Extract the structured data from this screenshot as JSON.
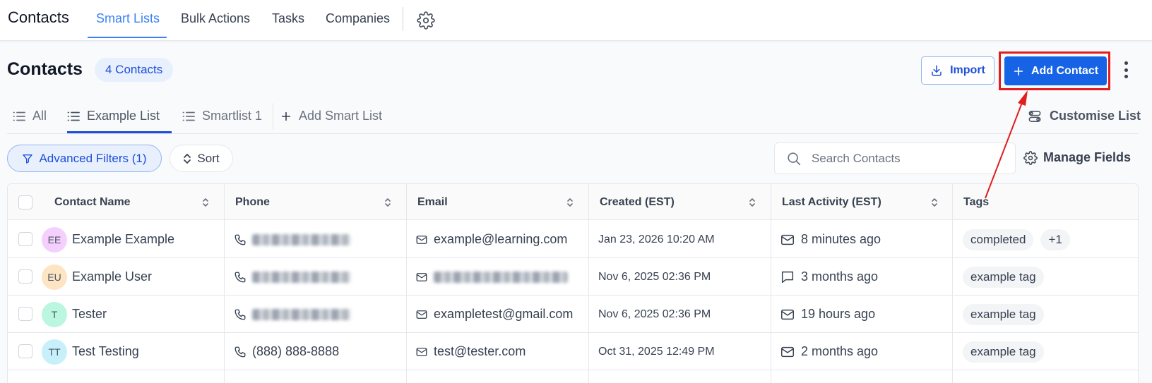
{
  "topnav": {
    "title": "Contacts",
    "tabs": [
      "Smart Lists",
      "Bulk Actions",
      "Tasks",
      "Companies"
    ],
    "active_tab": "Smart Lists",
    "settings_icon": "gear-icon"
  },
  "header": {
    "title": "Contacts",
    "count_label": "4 Contacts",
    "import_label": "Import",
    "add_contact_label": "Add Contact"
  },
  "list_tabs": {
    "items": [
      "All",
      "Example List",
      "Smartlist 1"
    ],
    "active": "Example List",
    "add_label": "Add Smart List",
    "customise_label": "Customise List"
  },
  "filters": {
    "advanced_label": "Advanced Filters (1)",
    "sort_label": "Sort",
    "search_placeholder": "Search Contacts",
    "search_value": "",
    "manage_fields_label": "Manage Fields"
  },
  "table": {
    "columns": [
      "Contact Name",
      "Phone",
      "Email",
      "Created (EST)",
      "Last Activity (EST)",
      "Tags"
    ],
    "rows": [
      {
        "initials": "EE",
        "avatar_color": "#f5d0fe",
        "name": "Example Example",
        "phone": "",
        "phone_blurred": true,
        "email": "example@learning.com",
        "email_blurred": false,
        "created": "Jan 23, 2026 10:20 AM",
        "activity": "8 minutes ago",
        "activity_icon": "mail-icon",
        "tags": [
          "completed",
          "+1"
        ]
      },
      {
        "initials": "EU",
        "avatar_color": "#fde4c3",
        "name": "Example User",
        "phone": "",
        "phone_blurred": true,
        "email": "",
        "email_blurred": true,
        "created": "Nov 6, 2025 02:36 PM",
        "activity": "3 months ago",
        "activity_icon": "chat-icon",
        "tags": [
          "example tag"
        ]
      },
      {
        "initials": "T",
        "avatar_color": "#bbf7e0",
        "name": "Tester",
        "phone": "",
        "phone_blurred": true,
        "email": "exampletest@gmail.com",
        "email_blurred": false,
        "created": "Nov 6, 2025 02:36 PM",
        "activity": "19 hours ago",
        "activity_icon": "mail-icon",
        "tags": [
          "example tag"
        ]
      },
      {
        "initials": "TT",
        "avatar_color": "#c7f0fb",
        "name": "Test Testing",
        "phone": "(888) 888-8888",
        "phone_blurred": false,
        "email": "test@tester.com",
        "email_blurred": false,
        "created": "Oct 31, 2025 12:49 PM",
        "activity": "2 months ago",
        "activity_icon": "mail-icon",
        "tags": [
          "example tag"
        ]
      }
    ]
  },
  "colors": {
    "primary": "#1763e6",
    "accent": "#3b82f6",
    "annotation": "#e11d1d"
  }
}
